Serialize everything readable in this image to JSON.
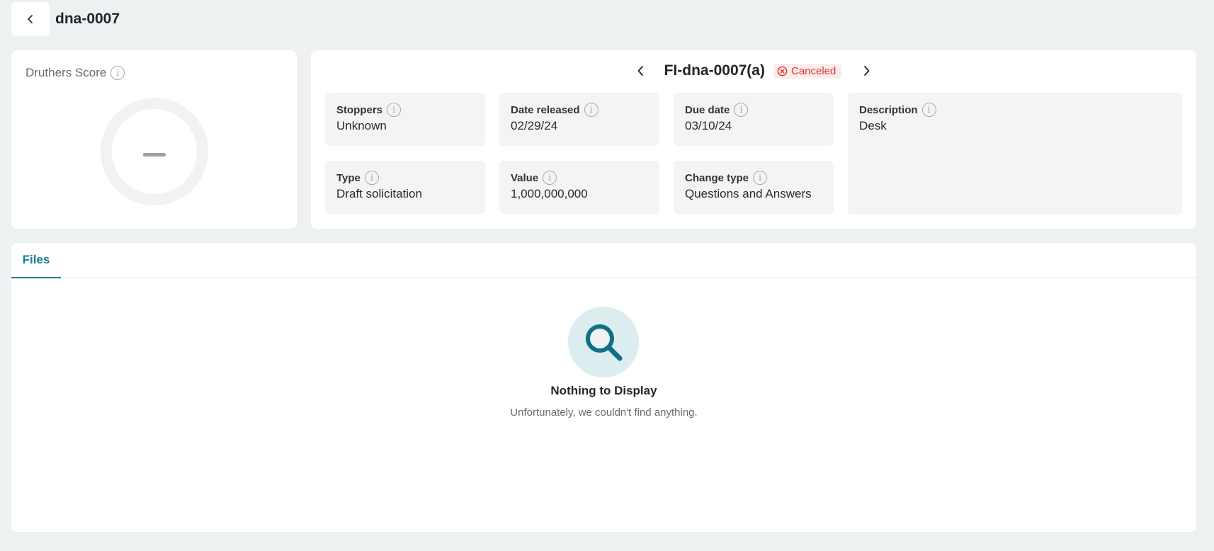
{
  "header": {
    "title": "dna-0007",
    "back_icon": "chevron-left-icon"
  },
  "score": {
    "title": "Druthers Score",
    "value": "–"
  },
  "detail": {
    "title": "FI-dna-0007(a)",
    "status": "Canceled",
    "status_color": "#d9322c",
    "fields": {
      "stoppers": {
        "label": "Stoppers",
        "value": "Unknown"
      },
      "date_released": {
        "label": "Date released",
        "value": "02/29/24"
      },
      "due_date": {
        "label": "Due date",
        "value": "03/10/24"
      },
      "description": {
        "label": "Description",
        "value": "Desk"
      },
      "type": {
        "label": "Type",
        "value": "Draft solicitation"
      },
      "value": {
        "label": "Value",
        "value": "1,000,000,000"
      },
      "change_type": {
        "label": "Change type",
        "value": "Questions and Answers"
      }
    }
  },
  "tabs": [
    {
      "label": "Files",
      "active": true
    }
  ],
  "empty_state": {
    "title": "Nothing to Display",
    "subtitle": "Unfortunately, we couldn't find anything.",
    "icon": "search-icon"
  },
  "colors": {
    "accent": "#1a7a92",
    "background": "#eef1f2"
  }
}
